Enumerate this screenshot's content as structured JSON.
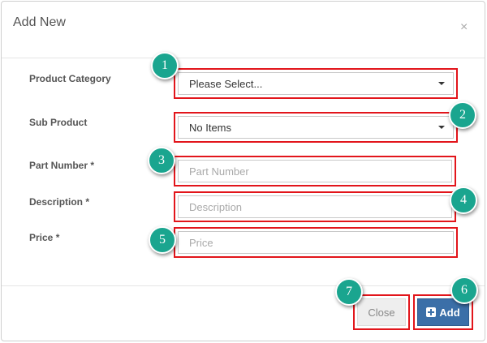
{
  "modal": {
    "title": "Add New",
    "close_glyph": "×"
  },
  "form": {
    "product_category": {
      "label": "Product Category",
      "value": "Please Select..."
    },
    "sub_product": {
      "label": "Sub Product",
      "value": "No Items"
    },
    "part_number": {
      "label": "Part Number *",
      "placeholder": "Part Number"
    },
    "description": {
      "label": "Description *",
      "placeholder": "Description"
    },
    "price": {
      "label": "Price *",
      "placeholder": "Price"
    }
  },
  "footer": {
    "close_label": "Close",
    "add_label": "Add"
  },
  "badges": [
    "1",
    "2",
    "3",
    "4",
    "5",
    "6",
    "7"
  ],
  "colors": {
    "highlight": "#e2151b",
    "badge": "#1aa58f",
    "primary_button": "#3b6fa8"
  },
  "icons": {
    "close": "close-icon",
    "add": "plus-square-icon",
    "dropdown": "caret-down-icon"
  }
}
